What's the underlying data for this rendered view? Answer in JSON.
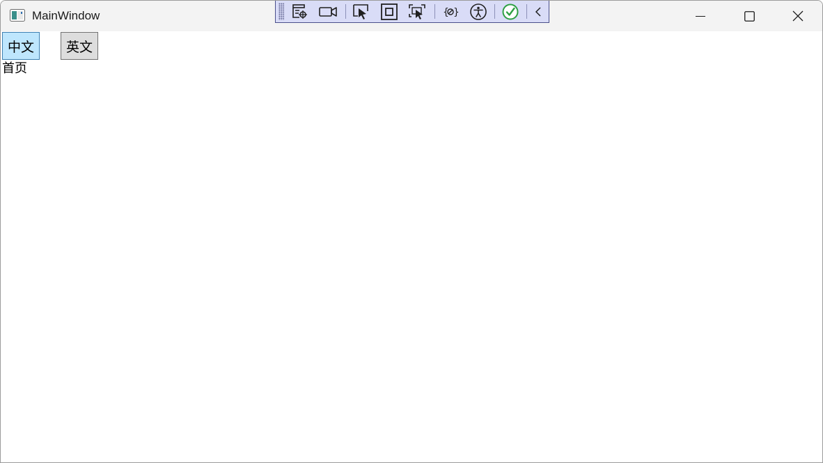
{
  "window": {
    "title": "MainWindow",
    "icons": {
      "app": "window-app-icon",
      "minimize": "minimize-icon",
      "maximize": "maximize-icon",
      "close": "close-icon"
    }
  },
  "devbar": {
    "tools": [
      {
        "icon": "visual-tree-icon"
      },
      {
        "icon": "camera-icon"
      },
      {
        "icon": "select-element-icon"
      },
      {
        "icon": "display-layout-adorners-icon"
      },
      {
        "icon": "track-focused-element-icon"
      },
      {
        "icon": "binding-failures-icon"
      },
      {
        "icon": "accessibility-icon"
      },
      {
        "icon": "hot-reload-status-icon"
      },
      {
        "icon": "collapse-chevron-icon"
      }
    ]
  },
  "content": {
    "chinese_button": "中文",
    "english_button": "英文",
    "page_label": "首页"
  },
  "colors": {
    "titlebar": "#f3f3f3",
    "devbar_bg": "#d9dcf7",
    "devbar_border": "#4a4f8a",
    "chinese_button_bg": "#bee6fd",
    "chinese_button_border": "#3c7fb1",
    "english_button_bg": "#dddddd",
    "check_green": "#2ea043"
  }
}
